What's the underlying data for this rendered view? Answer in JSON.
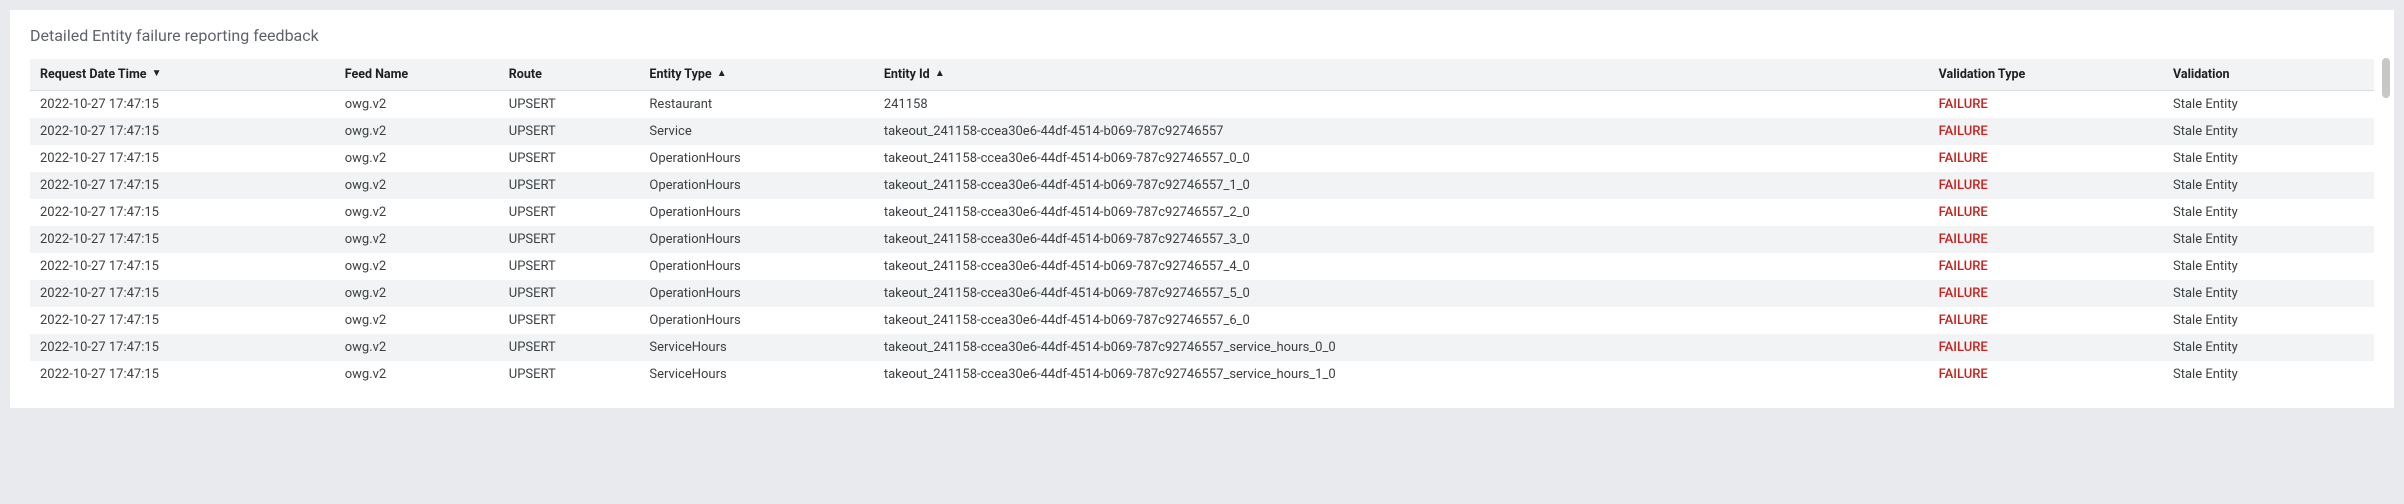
{
  "panel": {
    "title": "Detailed Entity failure reporting feedback"
  },
  "columns": [
    {
      "key": "request_date_time",
      "label": "Request Date Time",
      "sort": "desc"
    },
    {
      "key": "feed_name",
      "label": "Feed Name"
    },
    {
      "key": "route",
      "label": "Route"
    },
    {
      "key": "entity_type",
      "label": "Entity Type",
      "sort": "asc"
    },
    {
      "key": "entity_id",
      "label": "Entity Id",
      "sort": "asc"
    },
    {
      "key": "validation_type",
      "label": "Validation Type"
    },
    {
      "key": "validation",
      "label": "Validation"
    }
  ],
  "rows": [
    {
      "request_date_time": "2022-10-27 17:47:15",
      "feed_name": "owg.v2",
      "route": "UPSERT",
      "entity_type": "Restaurant",
      "entity_id": "241158",
      "validation_type": "FAILURE",
      "validation": "Stale Entity"
    },
    {
      "request_date_time": "2022-10-27 17:47:15",
      "feed_name": "owg.v2",
      "route": "UPSERT",
      "entity_type": "Service",
      "entity_id": "takeout_241158-ccea30e6-44df-4514-b069-787c92746557",
      "validation_type": "FAILURE",
      "validation": "Stale Entity"
    },
    {
      "request_date_time": "2022-10-27 17:47:15",
      "feed_name": "owg.v2",
      "route": "UPSERT",
      "entity_type": "OperationHours",
      "entity_id": "takeout_241158-ccea30e6-44df-4514-b069-787c92746557_0_0",
      "validation_type": "FAILURE",
      "validation": "Stale Entity"
    },
    {
      "request_date_time": "2022-10-27 17:47:15",
      "feed_name": "owg.v2",
      "route": "UPSERT",
      "entity_type": "OperationHours",
      "entity_id": "takeout_241158-ccea30e6-44df-4514-b069-787c92746557_1_0",
      "validation_type": "FAILURE",
      "validation": "Stale Entity"
    },
    {
      "request_date_time": "2022-10-27 17:47:15",
      "feed_name": "owg.v2",
      "route": "UPSERT",
      "entity_type": "OperationHours",
      "entity_id": "takeout_241158-ccea30e6-44df-4514-b069-787c92746557_2_0",
      "validation_type": "FAILURE",
      "validation": "Stale Entity"
    },
    {
      "request_date_time": "2022-10-27 17:47:15",
      "feed_name": "owg.v2",
      "route": "UPSERT",
      "entity_type": "OperationHours",
      "entity_id": "takeout_241158-ccea30e6-44df-4514-b069-787c92746557_3_0",
      "validation_type": "FAILURE",
      "validation": "Stale Entity"
    },
    {
      "request_date_time": "2022-10-27 17:47:15",
      "feed_name": "owg.v2",
      "route": "UPSERT",
      "entity_type": "OperationHours",
      "entity_id": "takeout_241158-ccea30e6-44df-4514-b069-787c92746557_4_0",
      "validation_type": "FAILURE",
      "validation": "Stale Entity"
    },
    {
      "request_date_time": "2022-10-27 17:47:15",
      "feed_name": "owg.v2",
      "route": "UPSERT",
      "entity_type": "OperationHours",
      "entity_id": "takeout_241158-ccea30e6-44df-4514-b069-787c92746557_5_0",
      "validation_type": "FAILURE",
      "validation": "Stale Entity"
    },
    {
      "request_date_time": "2022-10-27 17:47:15",
      "feed_name": "owg.v2",
      "route": "UPSERT",
      "entity_type": "OperationHours",
      "entity_id": "takeout_241158-ccea30e6-44df-4514-b069-787c92746557_6_0",
      "validation_type": "FAILURE",
      "validation": "Stale Entity"
    },
    {
      "request_date_time": "2022-10-27 17:47:15",
      "feed_name": "owg.v2",
      "route": "UPSERT",
      "entity_type": "ServiceHours",
      "entity_id": "takeout_241158-ccea30e6-44df-4514-b069-787c92746557_service_hours_0_0",
      "validation_type": "FAILURE",
      "validation": "Stale Entity"
    },
    {
      "request_date_time": "2022-10-27 17:47:15",
      "feed_name": "owg.v2",
      "route": "UPSERT",
      "entity_type": "ServiceHours",
      "entity_id": "takeout_241158-ccea30e6-44df-4514-b069-787c92746557_service_hours_1_0",
      "validation_type": "FAILURE",
      "validation": "Stale Entity"
    }
  ],
  "colors": {
    "failure": "#c5221f"
  }
}
